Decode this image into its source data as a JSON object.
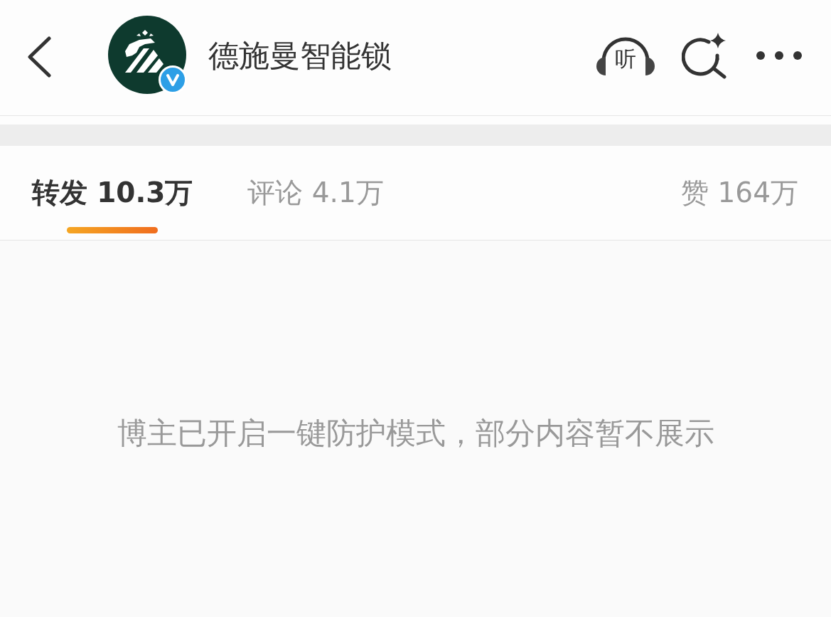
{
  "header": {
    "title": "德施曼智能锁",
    "verified": true,
    "listen_label": "听"
  },
  "tabs": [
    {
      "label": "转发 10.3万",
      "selected": true
    },
    {
      "label": "评论 4.1万",
      "selected": false
    }
  ],
  "likes": {
    "label": "赞 164万"
  },
  "notice": "博主已开启一键防护模式，部分内容暂不展示"
}
